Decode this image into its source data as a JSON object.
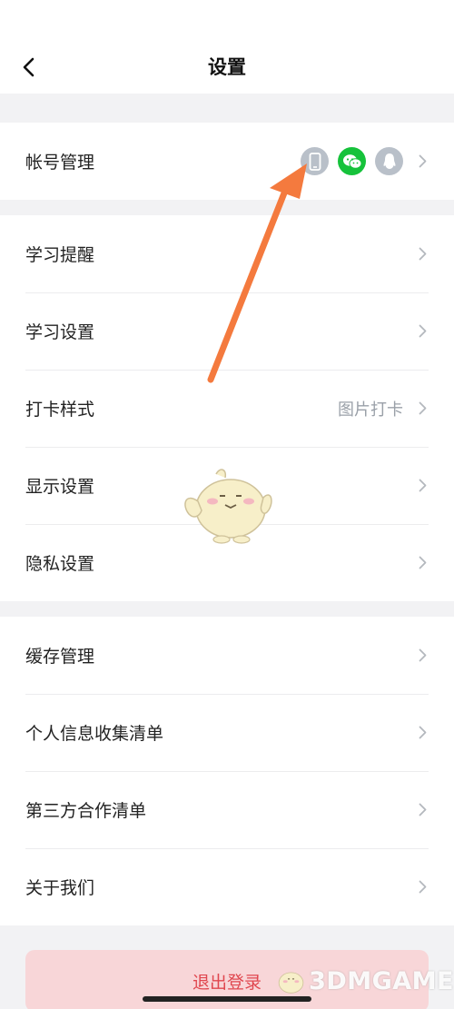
{
  "header": {
    "title": "设置"
  },
  "account": {
    "label": "帐号管理",
    "linked_icons": [
      "phone-icon",
      "wechat-icon",
      "qq-icon"
    ],
    "colors": {
      "phone": "#b9c0c9",
      "wechat": "#16c23b",
      "qq": "#b9c0c9"
    }
  },
  "group1": [
    {
      "label": "学习提醒",
      "value": ""
    },
    {
      "label": "学习设置",
      "value": ""
    },
    {
      "label": "打卡样式",
      "value": "图片打卡"
    },
    {
      "label": "显示设置",
      "value": ""
    },
    {
      "label": "隐私设置",
      "value": ""
    }
  ],
  "group2": [
    {
      "label": "缓存管理"
    },
    {
      "label": "个人信息收集清单"
    },
    {
      "label": "第三方合作清单"
    },
    {
      "label": "关于我们"
    }
  ],
  "logout": {
    "label": "退出登录",
    "color": "#e0474f",
    "bg": "#f8d6d8"
  },
  "watermark": {
    "text": "3DMGAME"
  },
  "annotation": {
    "arrow_color": "#f47a3e"
  }
}
